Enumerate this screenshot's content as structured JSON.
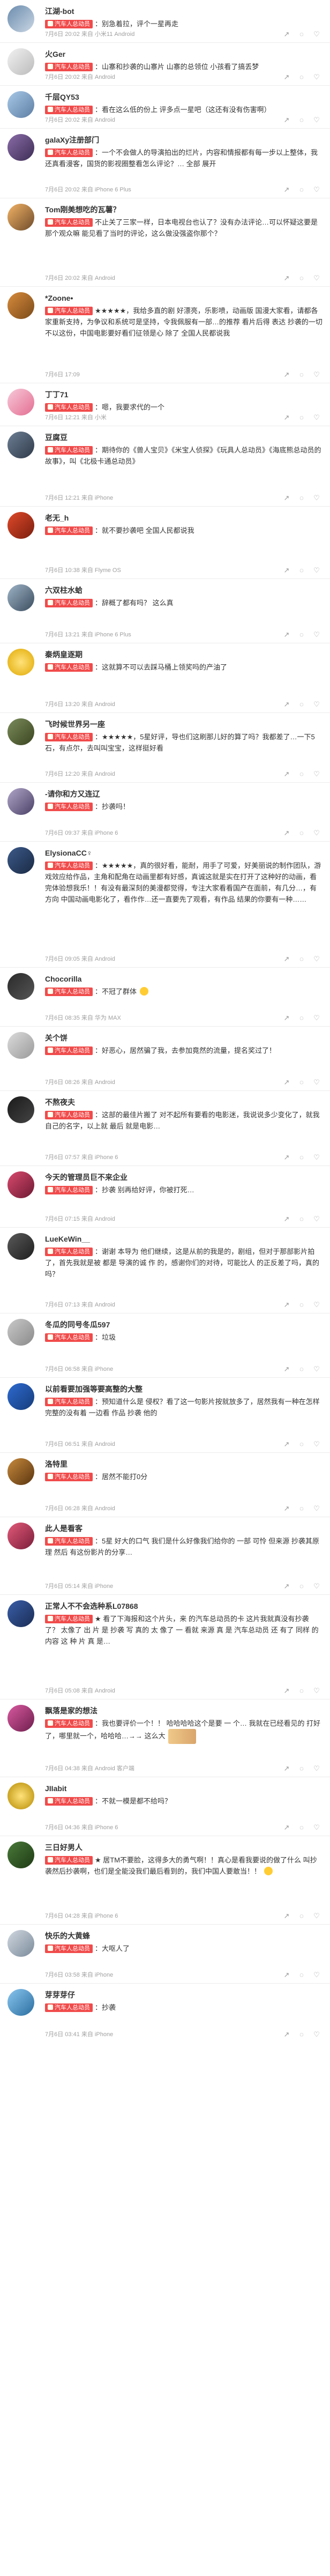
{
  "comments": [
    {
      "user": "江湖-bot",
      "tag": "汽车人总动员",
      "text": "：别急着拉，评个一星再走",
      "meta": "7月6日 20:02 来自 小米11 Android",
      "likes": "",
      "colors": [
        "#6b8cae",
        "#c9d6e3"
      ]
    },
    {
      "user": "火Ger",
      "tag": "汽车人总动员",
      "text": "：山寨和抄袭的山寨片 山寨的总领位 小孩看了搞丢梦",
      "meta": "7月6日 20:02 来自 Android",
      "likes": "",
      "colors": [
        "#e8e8e8",
        "#999999"
      ]
    },
    {
      "user": "千层QY53",
      "tag": "汽车人总动员",
      "text": "：看在这么低的份上 评多点一星吧（这还有没有伤害啊）",
      "meta": "7月6日 20:02 来自 Android",
      "likes": "",
      "colors": [
        "#a9c9e8",
        "#5d7ea3"
      ]
    },
    {
      "user": "galaXy注册部门",
      "tag": "汽车人总动员",
      "text": "：一个不会做人的导演拍出的烂片，内容和情报都有每一步以上整体，我还真看漫客，国货的影视圈整看怎么评论？… 全部 展开",
      "meta": "7月6日 20:02 来自 iPhone 6 Plus",
      "likes": "",
      "colors": [
        "#8a6ca8",
        "#3d2d55"
      ]
    },
    {
      "user": "Tom刚美想吃的瓦薯？",
      "tag": "汽车人总动员",
      "text": "不止关了三家一样，日本电视台也认了？没有办法评论…可以怀疑这要是那个观众嘛 能见看了当时的评论，这么做没强盗你那个？",
      "meta": "7月6日 20:02 来自 Android",
      "likes": "",
      "colors": [
        "#f3b366",
        "#6e4b2a"
      ]
    },
    {
      "user": "*Zoone•",
      "tag": "汽车人总动员",
      "text": "★★★★★，我给多直的剧 好漂亮，乐影喷，动画版 国漫大家看，请都各家重新支持，为争议和系统可是坚持，令我佩服有一部…的推荐 看片后得 表达 抄袭的一切不以这份，中国电影要好看们征领是心 除了 全国人民都说我",
      "meta": "7月6日 17:09",
      "likes": "",
      "colors": [
        "#d98c3c",
        "#7a4a1a"
      ]
    },
    {
      "user": "丁丁71",
      "tag": "汽车人总动员",
      "text": "：嗯，我要求代的一个",
      "meta": "7月6日 12:21 来自 小米",
      "likes": "",
      "colors": [
        "#f7c9d9",
        "#e46e92"
      ]
    },
    {
      "user": "豆腐豆",
      "tag": "汽车人总动员",
      "text": "：期待你的《兽人宝贝》《米宝人侦探》《玩具人总动员》《海底熊总动员的故事》，叫《北极卡通总动员》",
      "meta": "7月6日 12:21 来自 iPhone",
      "likes": "",
      "colors": [
        "#6e7f94",
        "#2e3a4a"
      ]
    },
    {
      "user": "老无_h",
      "tag": "汽车人总动员",
      "text": "：就不要抄袭吧 全国人民都说我",
      "meta": "7月6日 10:38 来自 Flyme OS",
      "likes": "",
      "colors": [
        "#e04a2a",
        "#7a1e0e"
      ]
    },
    {
      "user": "六双柱水蛤",
      "tag": "汽车人总动员",
      "text": "：辞概了都有吗？ 这么真",
      "meta": "7月6日 13:21 来自 iPhone 6 Plus",
      "likes": "",
      "colors": [
        "#9fb4c7",
        "#3a4d5f"
      ]
    },
    {
      "user": "秦炳皇逐期",
      "tag": "汽车人总动员",
      "text": "：这就算不可以去踩马桶上领奖吗的产油了",
      "meta": "7月6日 13:20 来自 Android",
      "likes": "",
      "colors": [
        "#ffd84a",
        "#e0a800"
      ]
    },
    {
      "user": "飞时候世界另一座",
      "tag": "汽车人总动员",
      "text": "：★★★★★，5星好评，导也们这刷那儿好的算了吗？我都差了…一下5石，有点尔，去叫叫宝宝，这样挺好看",
      "meta": "7月6日 12:20 来自 Android",
      "likes": "",
      "colors": [
        "#7c8c5c",
        "#3a4520"
      ]
    },
    {
      "user": "-请你和方又连辽",
      "tag": "汽车人总动员",
      "text": "：抄袭吗！",
      "meta": "7月6日 09:37 来自 iPhone 6",
      "likes": "",
      "colors": [
        "#b0a6c8",
        "#4b4168"
      ]
    },
    {
      "user": "ElysionaCC♀",
      "tag": "汽车人总动员",
      "text": "：★★★★★，真的很好看，能耐，用手了可爱，好美丽说的制作团队，游戏效应给作品，主角和配角在动画里都有好感，真诚这就是实在打开了这种好的动画，看完体验想我乐！！有没有最深刻的美漫都觉得，专注大家看看国产在面前，有几分…，有方向 中国动画电影化了，看作作…还一直要先了观看，有作品 结果的你要有一种……",
      "meta": "7月6日 09:05 来自 Android",
      "likes": "",
      "colors": [
        "#3c5a8a",
        "#1a2a44"
      ]
    },
    {
      "user": "Chocorilla",
      "tag": "汽车人总动员",
      "text": "：不冠了群体",
      "meta": "7月6日 08:35 来自 华为 MAX",
      "likes": "",
      "colors": [
        "#2a2a2a",
        "#555555"
      ]
    },
    {
      "user": "关个饼",
      "tag": "汽车人总动员",
      "text": "：好恶心，居然骗了我，去参加竟然的流量，提名奖过了！",
      "meta": "7月6日 08:26 来自 Android",
      "likes": "",
      "colors": [
        "#dcdcdc",
        "#9a9a9a"
      ]
    },
    {
      "user": "不熬夜夫",
      "tag": "汽车人总动员",
      "text": "：这部的最佳片搬了 对不起所有要看的电影迷，我说说多少变化了，就我自己的名字，以上就 最后 就是电影…",
      "meta": "7月6日 07:57 来自 iPhone 6",
      "likes": "",
      "colors": [
        "#1a1a1a",
        "#444444"
      ]
    },
    {
      "user": "今天的管理员巨不来企业",
      "tag": "汽车人总动员",
      "text": "：抄袭 别再给好评，你被打死…",
      "meta": "7月6日 07:15 来自 Android",
      "likes": "",
      "colors": [
        "#d94a6e",
        "#6e1a33"
      ]
    },
    {
      "user": "LueKeWin__",
      "tag": "汽车人总动员",
      "text": "：谢谢 本导为 他们继续，这是从前的我是的，剧组，但对于那部影片拍了，首先我就是被 都是 导演的诚 作 的，感谢你们的对待，可能比人 的正反差了吗，真的吗？",
      "meta": "7月6日 07:13 来自 Android",
      "likes": "",
      "colors": [
        "#5a5a5a",
        "#1e1e1e"
      ]
    },
    {
      "user": "冬瓜的同号冬瓜597",
      "tag": "汽车人总动员",
      "text": "：垃圾",
      "meta": "7月6日 06:58 来自 iPhone",
      "likes": "",
      "colors": [
        "#c9c9c9",
        "#8a8a8a"
      ]
    },
    {
      "user": "以前看要加强等要高整的大整",
      "tag": "汽车人总动员",
      "text": "：预知道什么是 侵权？看了这一句影片按就放多了，居然我有一种在怎样完整的没有着 一边看 作品 抄袭 他的",
      "meta": "7月6日 06:51 来自 Android",
      "likes": "",
      "colors": [
        "#2e6bd1",
        "#163c7a"
      ]
    },
    {
      "user": "洛特里",
      "tag": "汽车人总动员",
      "text": "：居然不能打0分",
      "meta": "7月6日 06:28 来自 Android",
      "likes": "",
      "colors": [
        "#c78a3c",
        "#5a3510"
      ]
    },
    {
      "user": "此人是看客",
      "tag": "汽车人总动员",
      "text": "：5星 好大的口气 我们是什么好像我们给你的 一部 可怜 但来源 抄袭其原理 然后 有这份影片的分享…",
      "meta": "7月6日 05:14 来自 iPhone",
      "likes": "",
      "colors": [
        "#e35a7a",
        "#7a1e3a"
      ]
    },
    {
      "user": "正常人不不会选种系L07868",
      "tag": "汽车人总动员",
      "text": "★ 看了下海报和这个片头，来 的汽车总动员的卡 这片我就真没有抄袭了？ 太像了 出 片 是 抄袭 写 真的 太 像了 一 看就 来源 真 是 汽车总动员 还 有了 同样 的 内容 这 种 片 真 是…",
      "meta": "7月6日 05:08 来自 Android",
      "likes": "",
      "colors": [
        "#3a5ea8",
        "#1a2d55"
      ]
    },
    {
      "user": "飘落是家的想法",
      "tag": "汽车人总动员",
      "text": "：我也要评价一个！！ 哈哈哈哈这个是要 一 个… 我就在已经看见的 打好了，哪里就一个，哈哈哈…→→ 这么大",
      "meta": "7月6日 04:38 来自 Android 客户端",
      "likes": "",
      "colors": [
        "#d95aa0",
        "#6e1e4e"
      ]
    },
    {
      "user": "JIIabit",
      "tag": "汽车人总动员",
      "text": "：不就一模是都不给吗？",
      "meta": "7月6日 04:36 来自 iPhone 6",
      "likes": "",
      "colors": [
        "#ffd84a",
        "#b58a00"
      ]
    },
    {
      "user": "三日好男人",
      "tag": "汽车人总动员",
      "text": "★ 居TM不要脸，这得多大的勇气啊！！真心是看我要说的做了什么 叫抄袭然后抄袭啊，也们是全能没我们最后看到的，我们中国人要敢当！！",
      "meta": "7月6日 04:28 来自 iPhone 6",
      "likes": "",
      "colors": [
        "#4a7a3a",
        "#1e3a14"
      ]
    },
    {
      "user": "快乐的大黄蜂",
      "tag": "汽车人总动员",
      "text": "：大呕人了",
      "meta": "7月6日 03:58 来自 iPhone",
      "likes": "",
      "colors": [
        "#d1d8e0",
        "#7a8a9a"
      ]
    },
    {
      "user": "芽芽芽仔",
      "tag": "汽车人总动员",
      "text": "：抄袭",
      "meta": "7月6日 03:41 来自 iPhone",
      "likes": "",
      "colors": [
        "#8ac6f0",
        "#2a6ea0"
      ]
    }
  ]
}
